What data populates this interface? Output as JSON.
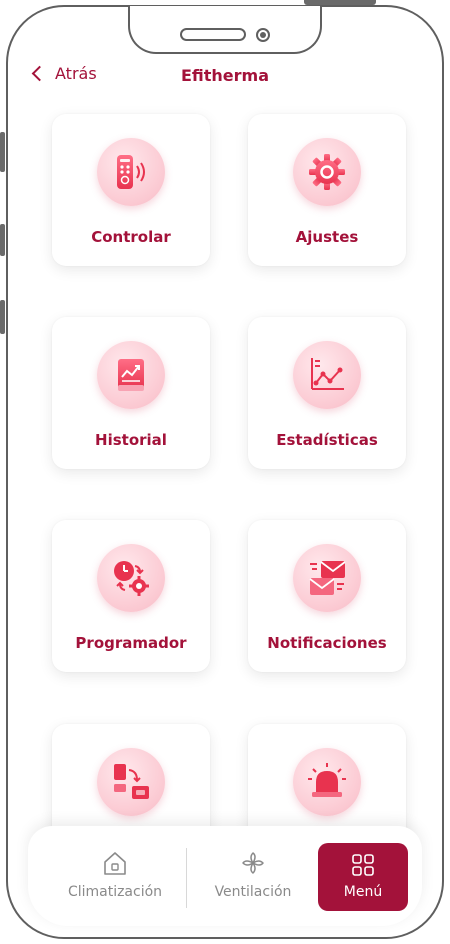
{
  "header": {
    "back_label": "Atrás",
    "title": "Efitherma"
  },
  "menu": {
    "items": [
      {
        "label": "Controlar",
        "icon": "remote-control-icon"
      },
      {
        "label": "Ajustes",
        "icon": "gear-icon"
      },
      {
        "label": "Historial",
        "icon": "history-book-icon"
      },
      {
        "label": "Estadísticas",
        "icon": "line-chart-icon"
      },
      {
        "label": "Programador",
        "icon": "clock-schedule-icon"
      },
      {
        "label": "Notificaciones",
        "icon": "envelope-icon"
      },
      {
        "label": "",
        "icon": "device-transfer-icon"
      },
      {
        "label": "",
        "icon": "alarm-bell-icon"
      }
    ]
  },
  "bottom_nav": {
    "climatizacion": "Climatización",
    "ventilacion": "Ventilación",
    "menu": "Menú"
  },
  "colors": {
    "accent": "#a3123a",
    "icon_bg": "#fbc9d2",
    "icon_fg": "#f0455e"
  }
}
